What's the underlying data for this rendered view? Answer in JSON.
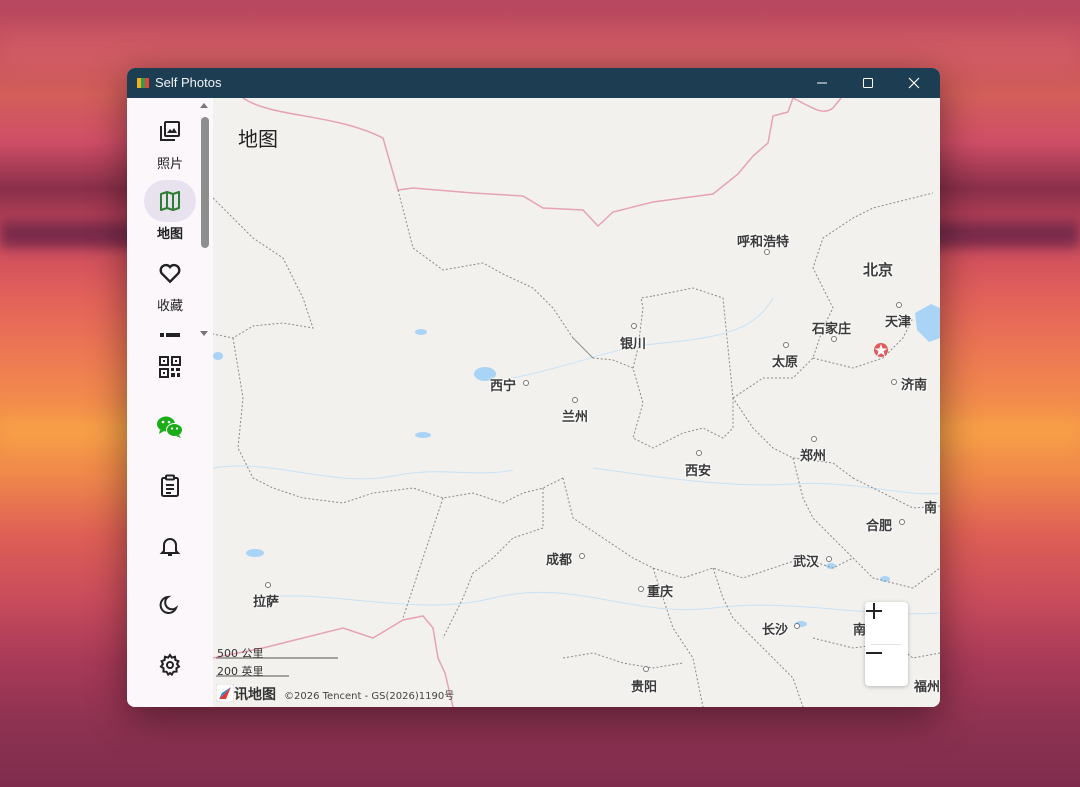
{
  "window": {
    "title": "Self Photos",
    "controls": {
      "minimize": "minimize-icon",
      "maximize": "maximize-icon",
      "close": "close-icon"
    }
  },
  "sidebar": {
    "items": [
      {
        "label": "照片",
        "icon": "photos-icon",
        "active": false
      },
      {
        "label": "地图",
        "icon": "map-icon",
        "active": true
      },
      {
        "label": "收藏",
        "icon": "heart-icon",
        "active": false
      },
      {
        "label": "",
        "icon": "more-icon",
        "active": false
      },
      {
        "label": "",
        "icon": "qr-code-icon",
        "active": false
      },
      {
        "label": "",
        "icon": "wechat-icon",
        "active": false
      },
      {
        "label": "",
        "icon": "clipboard-icon",
        "active": false
      },
      {
        "label": "",
        "icon": "bell-icon",
        "active": false
      },
      {
        "label": "",
        "icon": "moon-icon",
        "active": false
      },
      {
        "label": "",
        "icon": "gear-icon",
        "active": false
      }
    ]
  },
  "map": {
    "title": "地图",
    "cities": [
      "呼和浩特",
      "北京",
      "天津",
      "石家庄",
      "银川",
      "太原",
      "济南",
      "西宁",
      "兰州",
      "郑州",
      "西安",
      "南",
      "合肥",
      "成都",
      "武汉",
      "拉萨",
      "重庆",
      "长沙",
      "南",
      "福州",
      "贵阳"
    ],
    "scale": {
      "metric": "500 公里",
      "imperial": "200 英里"
    },
    "brand": "腾讯地图",
    "copyright": "©2026 Tencent - GS(2026)1190号",
    "zoom": {
      "in": "+",
      "out": "−"
    }
  },
  "colors": {
    "titlebar": "#1c3d52",
    "active_nav": "#e8e2ee",
    "border_pink": "#e6a2b8",
    "water": "#a9d4f5",
    "wechat": "#1aad19",
    "map_icon": "#2e7d32"
  }
}
